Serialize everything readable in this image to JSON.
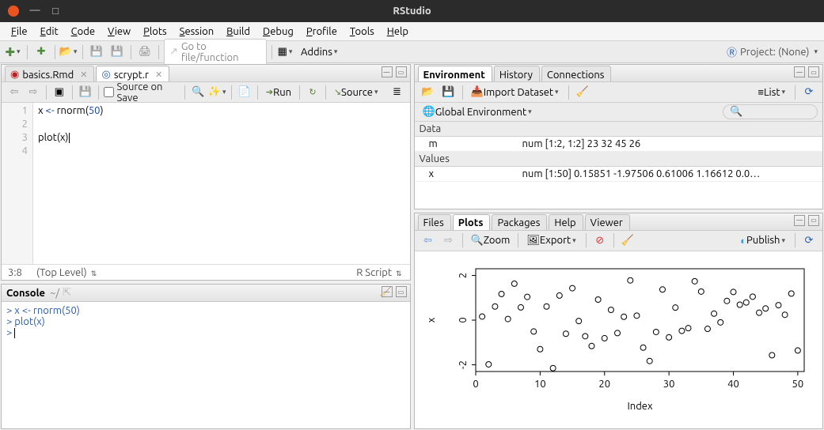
{
  "window": {
    "title": "RStudio"
  },
  "menu": [
    "File",
    "Edit",
    "Code",
    "View",
    "Plots",
    "Session",
    "Build",
    "Debug",
    "Profile",
    "Tools",
    "Help"
  ],
  "toolbar": {
    "goto_placeholder": "Go to file/function",
    "addins": "Addins",
    "project_label": "Project: (None)"
  },
  "source": {
    "tabs": [
      {
        "label": "basics.Rmd",
        "active": false
      },
      {
        "label": "scrypt.r",
        "active": true
      }
    ],
    "toolbar": {
      "source_on_save": "Source on Save",
      "run": "Run",
      "source": "Source"
    },
    "gutter": [
      "1",
      "2",
      "3",
      "4"
    ],
    "lines": [
      {
        "parts": [
          {
            "t": "x "
          },
          {
            "t": "<- ",
            "c": "syn-kw"
          },
          {
            "t": "rnorm"
          },
          {
            "t": "(",
            "c": ""
          },
          {
            "t": "50",
            "c": "syn-num"
          },
          {
            "t": ")"
          }
        ]
      },
      {
        "parts": []
      },
      {
        "parts": [
          {
            "t": "plot"
          },
          {
            "t": "("
          },
          {
            "t": "x"
          },
          {
            "t": ")",
            "cursor": true
          }
        ]
      },
      {
        "parts": []
      }
    ],
    "status": {
      "pos": "3:8",
      "scope": "(Top Level)",
      "lang": "R Script"
    }
  },
  "console": {
    "title": "Console",
    "path": "~/",
    "lines": [
      "x <- rnorm(50)",
      "plot(x)",
      ""
    ]
  },
  "env": {
    "tabs": [
      "Environment",
      "History",
      "Connections"
    ],
    "toolbar": {
      "import": "Import Dataset",
      "scope": "Global Environment",
      "view": "List"
    },
    "sections": [
      {
        "name": "Data",
        "rows": [
          {
            "k": "m",
            "v": "num [1:2, 1:2] 23 32 45 26"
          }
        ]
      },
      {
        "name": "Values",
        "rows": [
          {
            "k": "x",
            "v": "num [1:50] 0.15851 -1.97506 0.61006 1.16612 0.0…"
          }
        ]
      }
    ]
  },
  "plots": {
    "tabs": [
      "Files",
      "Plots",
      "Packages",
      "Help",
      "Viewer"
    ],
    "toolbar": {
      "zoom": "Zoom",
      "export": "Export",
      "publish": "Publish"
    },
    "chart_data": {
      "type": "scatter",
      "x": [
        1,
        2,
        3,
        4,
        5,
        6,
        7,
        8,
        9,
        10,
        11,
        12,
        13,
        14,
        15,
        16,
        17,
        18,
        19,
        20,
        21,
        22,
        23,
        24,
        25,
        26,
        27,
        28,
        29,
        30,
        31,
        32,
        33,
        34,
        35,
        36,
        37,
        38,
        39,
        40,
        41,
        42,
        43,
        44,
        45,
        46,
        47,
        48,
        49,
        50
      ],
      "y": [
        0.16,
        -1.98,
        0.61,
        1.17,
        0.05,
        1.63,
        0.57,
        1.04,
        -0.51,
        -1.3,
        0.61,
        -2.15,
        1.1,
        -0.61,
        1.43,
        -0.04,
        -0.72,
        -1.16,
        0.92,
        -0.81,
        0.46,
        -0.58,
        0.15,
        1.78,
        0.2,
        -1.23,
        -1.83,
        -0.53,
        1.37,
        -0.77,
        0.56,
        -0.48,
        -0.36,
        1.74,
        1.28,
        -0.39,
        0.29,
        -0.1,
        0.86,
        1.26,
        0.69,
        0.79,
        1.05,
        0.33,
        0.52,
        -1.57,
        0.67,
        0.24,
        1.19,
        -1.36
      ],
      "xlabel": "Index",
      "ylabel": "x",
      "xticks": [
        0,
        10,
        20,
        30,
        40,
        50
      ],
      "yticks": [
        -2,
        0,
        2
      ],
      "xlim": [
        0,
        51
      ],
      "ylim": [
        -2.3,
        2.3
      ]
    }
  }
}
